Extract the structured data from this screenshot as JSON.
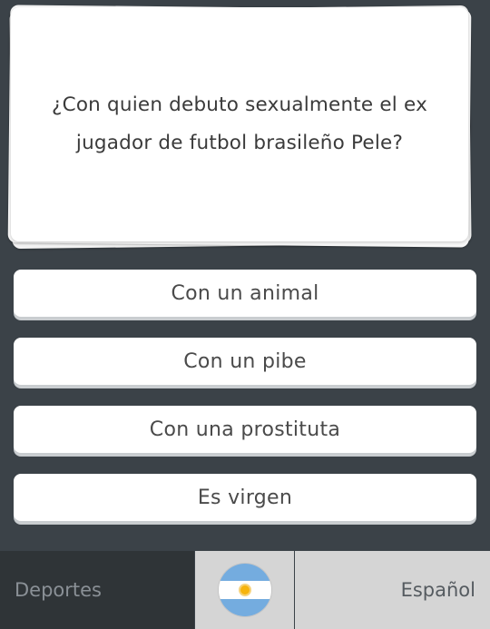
{
  "question": {
    "text": "¿Con quien debuto sexualmente el ex jugador de futbol brasileño Pele?"
  },
  "answers": [
    {
      "label": "Con un animal"
    },
    {
      "label": "Con un pibe"
    },
    {
      "label": "Con una prostituta"
    },
    {
      "label": "Es virgen"
    }
  ],
  "bottom_bar": {
    "category": "Deportes",
    "flag_icon": "argentina-flag-icon",
    "language": "Español"
  },
  "colors": {
    "background": "#3b4248",
    "card": "#ffffff",
    "button_shadow": "#c9cdd0",
    "category_bg": "#2f3437",
    "light_bar_bg": "#d5d5d5",
    "flag_blue": "#74acdf",
    "flag_sun": "#f6b40e"
  }
}
